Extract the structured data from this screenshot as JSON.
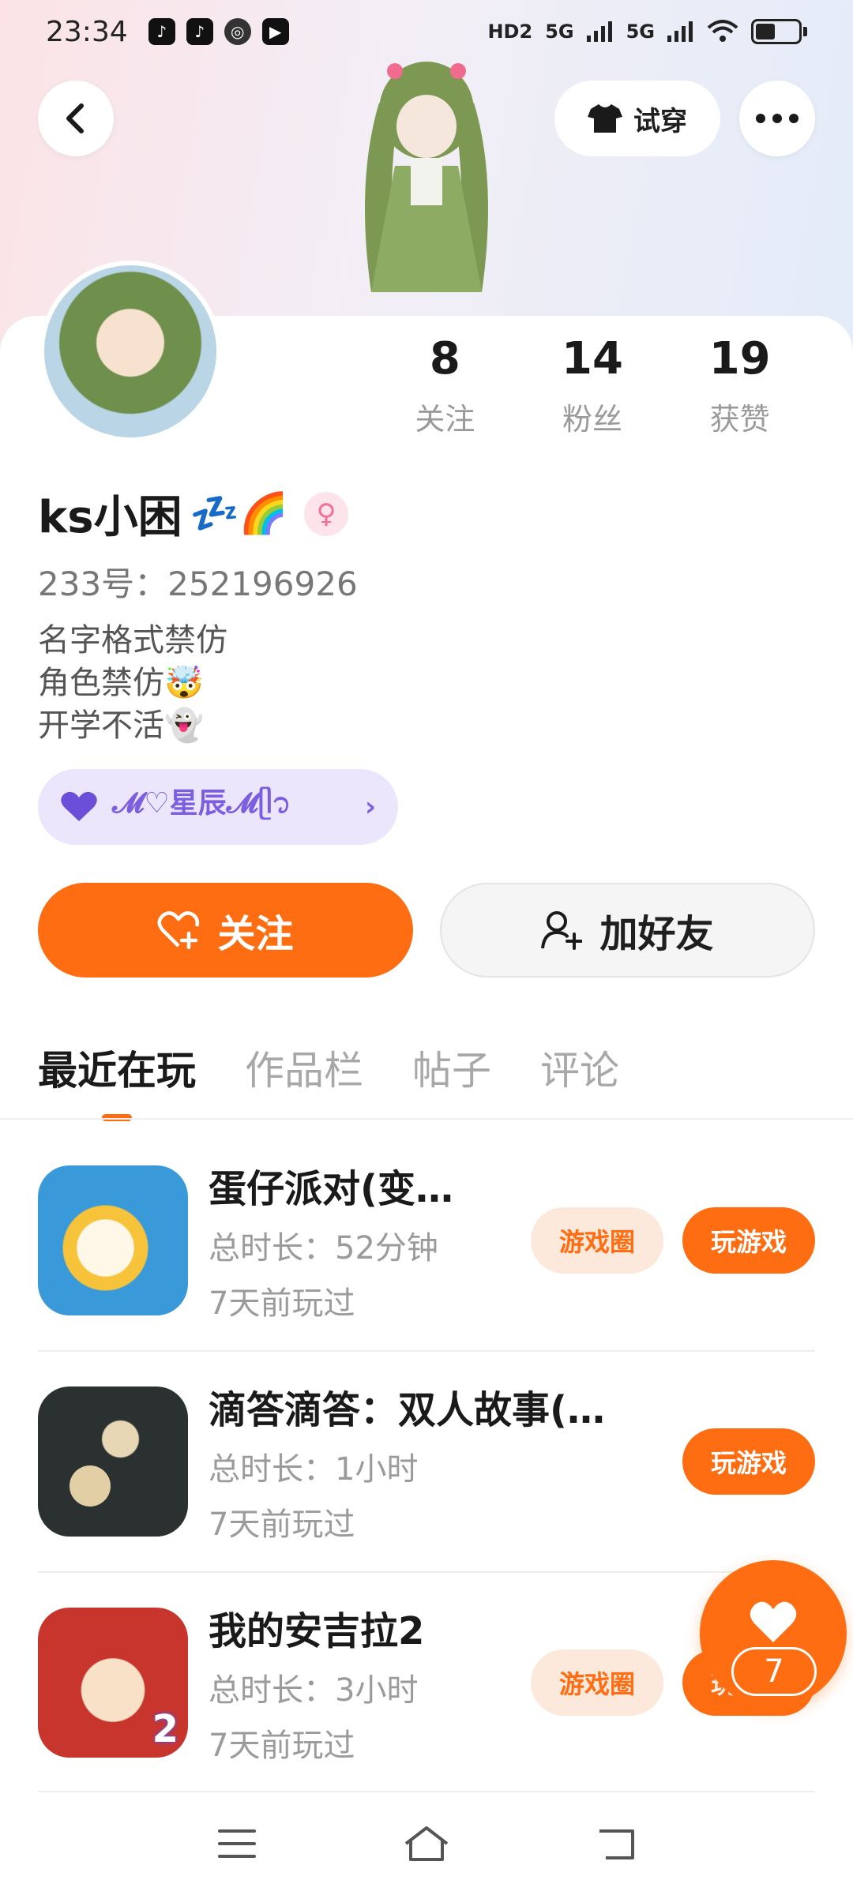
{
  "status_bar": {
    "time": "23:34",
    "network_labels": [
      "HD2",
      "5G",
      "5G"
    ]
  },
  "header": {
    "try_on_label": "试穿"
  },
  "stats": [
    {
      "value": "8",
      "label": "关注"
    },
    {
      "value": "14",
      "label": "粉丝"
    },
    {
      "value": "19",
      "label": "获赞"
    }
  ],
  "profile": {
    "name": "ks小困",
    "name_emojis": "💤🌈",
    "gender_symbol": "♀",
    "uid": "233号：252196926",
    "bio_lines": [
      "名字格式禁仿",
      "角色禁仿🤯",
      "开学不活👻"
    ],
    "group_chip": "𝓜♡星辰𝓜ᥫ᭡"
  },
  "actions": {
    "follow_label": "关注",
    "add_friend_label": "加好友"
  },
  "tabs": [
    {
      "label": "最近在玩",
      "active": true
    },
    {
      "label": "作品栏",
      "active": false
    },
    {
      "label": "帖子",
      "active": false
    },
    {
      "label": "评论",
      "active": false
    }
  ],
  "games": [
    {
      "title": "蛋仔派对(变…",
      "duration": "总时长：52分钟",
      "last_played": "7天前玩过",
      "circle_label": "游戏圈",
      "play_label": "玩游戏",
      "icon": "eggy-party-icon"
    },
    {
      "title": "滴答滴答：双人故事(…",
      "duration": "总时长：1小时",
      "last_played": "7天前玩过",
      "circle_label": "",
      "play_label": "玩游戏",
      "icon": "pocket-watch-icon"
    },
    {
      "title": "我的安吉拉2",
      "duration": "总时长：3小时",
      "last_played": "7天前玩过",
      "circle_label": "游戏圈",
      "play_label": "玩游戏",
      "icon": "angela-icon",
      "icon_badge": "2"
    }
  ],
  "floating_like": {
    "count": "7"
  },
  "colors": {
    "accent": "#fe6d12",
    "accent_light": "#fde9dc",
    "chip_bg": "#ebe6fb",
    "chip_text": "#7b5fe0"
  }
}
